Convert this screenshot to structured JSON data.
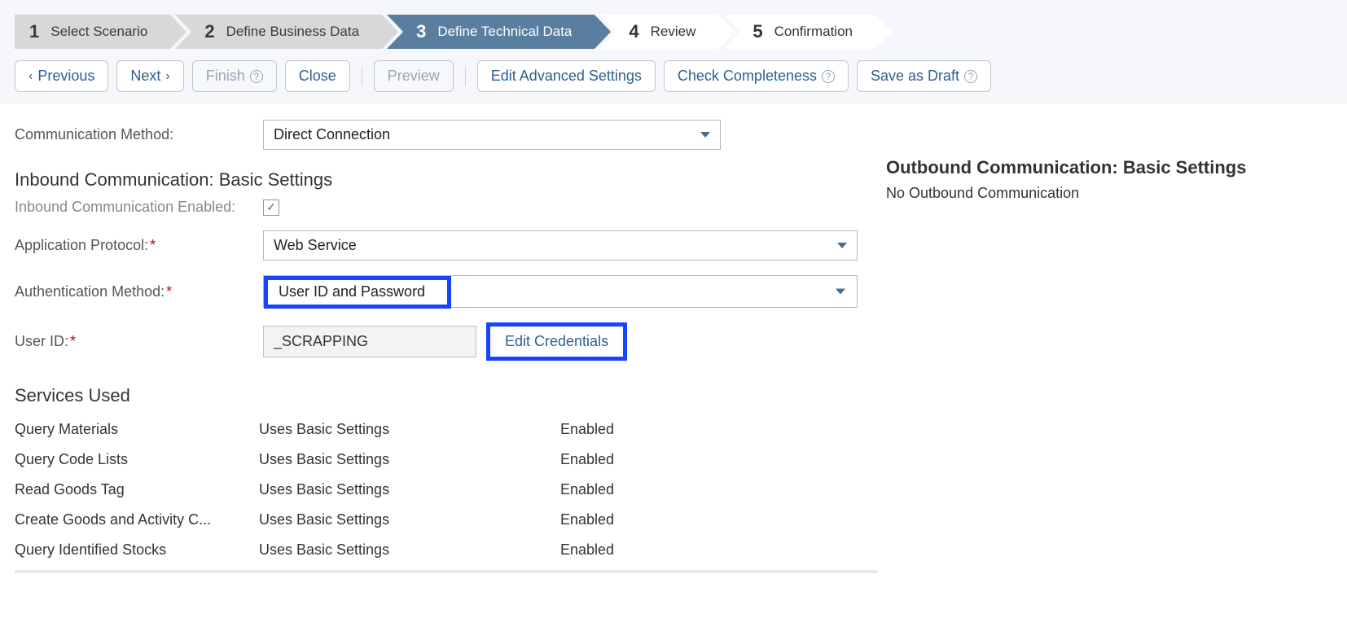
{
  "wizard": {
    "steps": [
      {
        "num": "1",
        "label": "Select Scenario"
      },
      {
        "num": "2",
        "label": "Define Business Data"
      },
      {
        "num": "3",
        "label": "Define Technical Data"
      },
      {
        "num": "4",
        "label": "Review"
      },
      {
        "num": "5",
        "label": "Confirmation"
      }
    ]
  },
  "toolbar": {
    "previous": "Previous",
    "next": "Next",
    "finish": "Finish",
    "close": "Close",
    "preview": "Preview",
    "edit_advanced": "Edit Advanced Settings",
    "check_completeness": "Check Completeness",
    "save_draft": "Save as Draft"
  },
  "comm_method": {
    "label": "Communication Method:",
    "value": "Direct Connection"
  },
  "inbound": {
    "heading": "Inbound Communication: Basic Settings",
    "enabled_label": "Inbound Communication Enabled:",
    "app_protocol_label": "Application Protocol:",
    "app_protocol_value": "Web Service",
    "auth_method_label": "Authentication Method:",
    "auth_method_value": "User ID and Password",
    "user_id_label": "User ID:",
    "user_id_value": "_SCRAPPING",
    "edit_credentials": "Edit Credentials"
  },
  "services": {
    "heading": "Services Used",
    "rows": [
      {
        "name": "Query Materials",
        "setting": "Uses Basic Settings",
        "status": "Enabled"
      },
      {
        "name": "Query Code Lists",
        "setting": "Uses Basic Settings",
        "status": "Enabled"
      },
      {
        "name": "Read Goods Tag",
        "setting": "Uses Basic Settings",
        "status": "Enabled"
      },
      {
        "name": "Create Goods and Activity C...",
        "setting": "Uses Basic Settings",
        "status": "Enabled"
      },
      {
        "name": "Query Identified Stocks",
        "setting": "Uses Basic Settings",
        "status": "Enabled"
      }
    ]
  },
  "outbound": {
    "heading": "Outbound Communication: Basic Settings",
    "text": "No Outbound Communication"
  }
}
